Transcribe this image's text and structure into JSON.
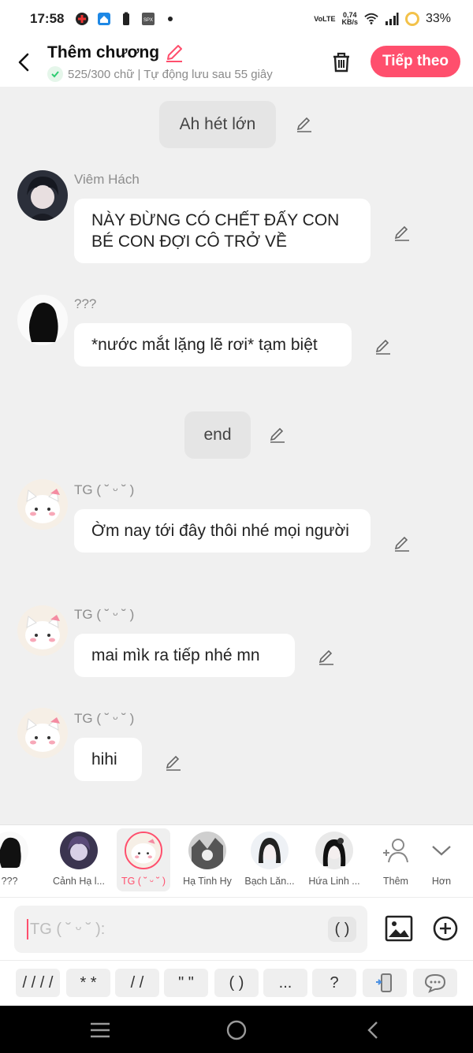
{
  "status_bar": {
    "time": "17:58",
    "network_label": "VoLTE",
    "speed_value": "0,74",
    "speed_unit": "KB/s",
    "battery": "33%",
    "icons": [
      "app-icon",
      "home-icon",
      "battery-saver-icon",
      "spx-icon",
      "dot-icon",
      "wifi-icon",
      "signal-icon",
      "battery-ring-icon"
    ]
  },
  "header": {
    "title": "Thêm chương",
    "subtitle": "525/300 chữ | Tự động lưu sau 55 giây",
    "next_label": "Tiếp theo",
    "accent": "#ff4f6d"
  },
  "messages": [
    {
      "type": "narration",
      "text": "Ah hét lớn"
    },
    {
      "type": "dialogue",
      "speaker": "Viêm Hách",
      "avatar": "avatar-viem-hach",
      "text": "NÀY ĐỪNG CÓ CHẾT ĐẤY CON BÉ CON ĐỢI CÔ TRỞ VỀ"
    },
    {
      "type": "dialogue",
      "speaker": "???",
      "avatar": "avatar-silhouette",
      "text": "*nước mắt lặng lẽ rơi* tạm biệt"
    },
    {
      "type": "narration",
      "text": "end"
    },
    {
      "type": "dialogue",
      "speaker": "TG ( ˘ ᵕ ˘ )",
      "avatar": "avatar-cat",
      "text": "Ờm nay tới đây thôi nhé mọi người"
    },
    {
      "type": "dialogue",
      "speaker": "TG ( ˘ ᵕ ˘ )",
      "avatar": "avatar-cat",
      "text": "mai mìk ra tiếp nhé mn"
    },
    {
      "type": "dialogue",
      "speaker": "TG ( ˘ ᵕ ˘ )",
      "avatar": "avatar-cat",
      "text": "hihi"
    }
  ],
  "characters": [
    {
      "name": "???"
    },
    {
      "name": "Cảnh Hạ l..."
    },
    {
      "name": "TG ( ˘ ᵕ ˘ )",
      "selected": true
    },
    {
      "name": "Hạ Tinh Hy"
    },
    {
      "name": "Bạch Lăn..."
    },
    {
      "name": "Hứa Linh ..."
    },
    {
      "name": "Thêm"
    },
    {
      "name": "Hơn"
    }
  ],
  "input": {
    "placeholder": "TG ( ˘ ᵕ ˘ ):",
    "paren_label": "( )"
  },
  "quick_symbols": [
    "/ / / /",
    "* *",
    "/ /",
    "\" \"",
    "( )",
    "...",
    "?"
  ]
}
